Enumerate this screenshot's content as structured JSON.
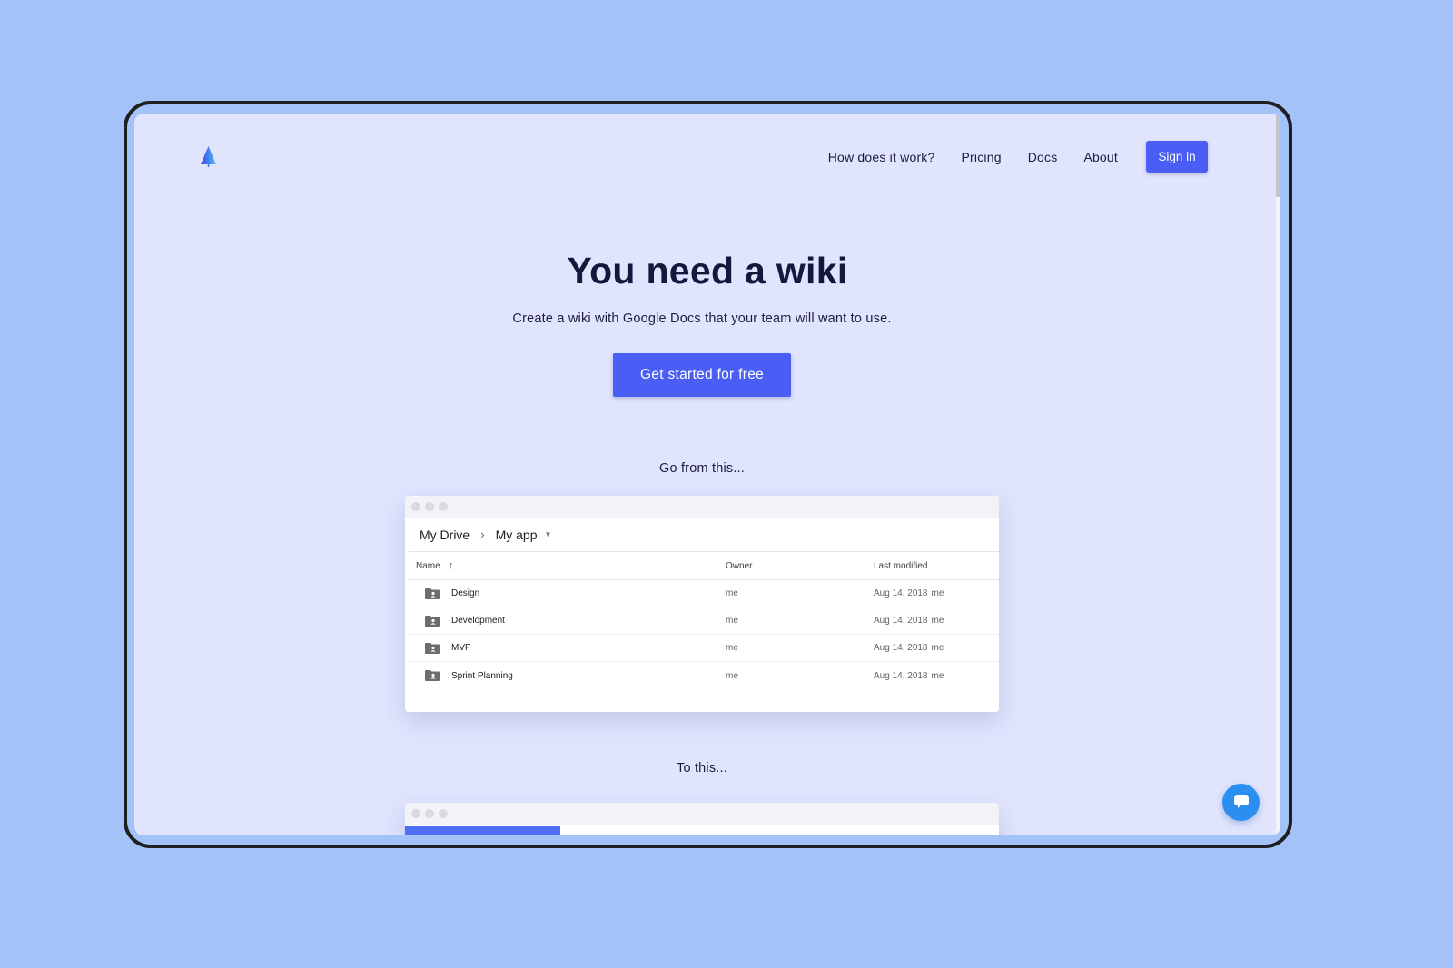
{
  "nav": {
    "logo": "tree-logo",
    "links": [
      "How does it work?",
      "Pricing",
      "Docs",
      "About"
    ],
    "signin_label": "Sign in"
  },
  "hero": {
    "title": "You need a wiki",
    "subtitle": "Create a wiki with Google Docs that your team will want to use.",
    "cta_label": "Get started for free"
  },
  "sections": {
    "from_label": "Go from this...",
    "to_label": "To this..."
  },
  "drive_mock": {
    "breadcrumb": [
      "My Drive",
      "My app"
    ],
    "columns": [
      "Name",
      "Owner",
      "Last modified"
    ],
    "rows": [
      {
        "name": "Design",
        "owner": "me",
        "modified": "Aug 14, 2018",
        "modified_by": "me"
      },
      {
        "name": "Development",
        "owner": "me",
        "modified": "Aug 14, 2018",
        "modified_by": "me"
      },
      {
        "name": "MVP",
        "owner": "me",
        "modified": "Aug 14, 2018",
        "modified_by": "me"
      },
      {
        "name": "Sprint Planning",
        "owner": "me",
        "modified": "Aug 14, 2018",
        "modified_by": "me"
      }
    ]
  },
  "colors": {
    "accent": "#4a5ef6",
    "page_bg": "#e0e4fd",
    "outer_bg": "#a3c2f7",
    "chat": "#2a8ff0"
  },
  "chat": {
    "icon": "chat-bubble-icon"
  }
}
